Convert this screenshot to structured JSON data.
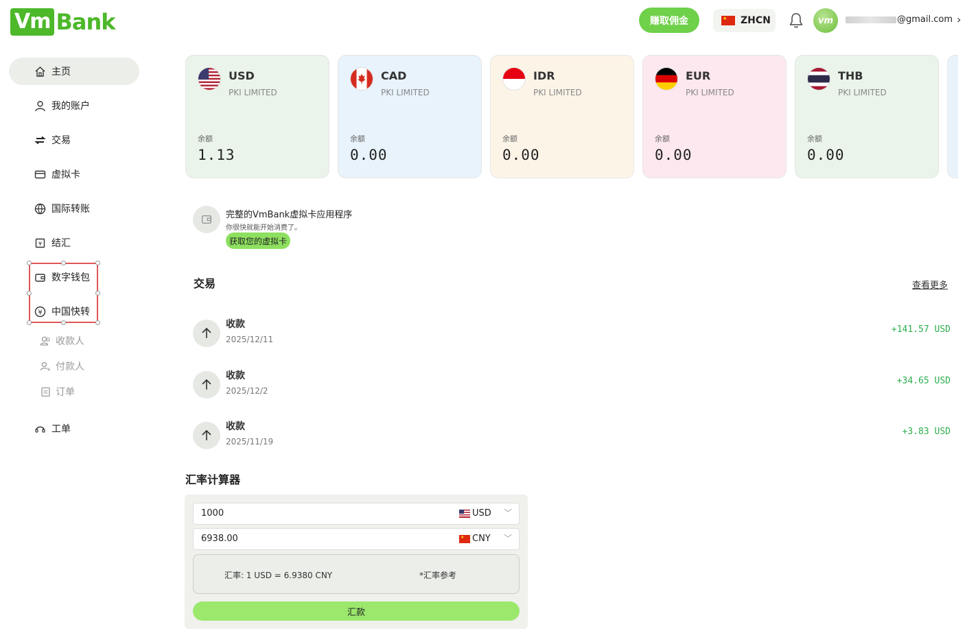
{
  "header": {
    "logo_box": "Vm",
    "logo_text": "Bank",
    "earn_button": "赚取佣金",
    "lang_label": "ZHCN",
    "avatar_text": "vm",
    "email_suffix": "@gmail.com"
  },
  "sidebar": {
    "items": [
      {
        "label": "主页",
        "icon": "home-icon"
      },
      {
        "label": "我的账户",
        "icon": "user-icon"
      },
      {
        "label": "交易",
        "icon": "transfer-icon"
      },
      {
        "label": "虚拟卡",
        "icon": "card-icon"
      },
      {
        "label": "国际转账",
        "icon": "globe-icon"
      },
      {
        "label": "结汇",
        "icon": "exchange-icon"
      },
      {
        "label": "数字钱包",
        "icon": "wallet-icon"
      },
      {
        "label": "中国快转",
        "icon": "yuan-icon"
      }
    ],
    "sub_items": [
      {
        "label": "收款人",
        "icon": "payee-icon"
      },
      {
        "label": "付款人",
        "icon": "payer-icon"
      },
      {
        "label": "订单",
        "icon": "order-icon"
      }
    ],
    "ticket": {
      "label": "工单",
      "icon": "headset-icon"
    }
  },
  "cards": [
    {
      "code": "USD",
      "holder": "PKI LIMITED",
      "balance_label": "余额",
      "balance": "1.13",
      "bg": "#eaf4ea"
    },
    {
      "code": "CAD",
      "holder": "PKI LIMITED",
      "balance_label": "余额",
      "balance": "0.00",
      "bg": "#e8f3fb"
    },
    {
      "code": "IDR",
      "holder": "PKI LIMITED",
      "balance_label": "余额",
      "balance": "0.00",
      "bg": "#fdf4e8"
    },
    {
      "code": "EUR",
      "holder": "PKI LIMITED",
      "balance_label": "余额",
      "balance": "0.00",
      "bg": "#fce8ee"
    },
    {
      "code": "THB",
      "holder": "PKI LIMITED",
      "balance_label": "余额",
      "balance": "0.00",
      "bg": "#eaf4ea"
    }
  ],
  "promo": {
    "title": "完整的VmBank虚拟卡应用程序",
    "subtitle": "你很快就能开始消费了。",
    "button": "获取您的虚拟卡"
  },
  "transactions": {
    "title": "交易",
    "view_more": "查看更多",
    "items": [
      {
        "title": "收款",
        "date": "2025/12/11",
        "amount": "+141.57 USD"
      },
      {
        "title": "收款",
        "date": "2025/12/2",
        "amount": "+34.65 USD"
      },
      {
        "title": "收款",
        "date": "2025/11/19",
        "amount": "+3.83 USD"
      }
    ]
  },
  "calculator": {
    "title": "汇率计算器",
    "from_value": "1000",
    "from_currency": "USD",
    "to_value": "6938.00",
    "to_currency": "CNY",
    "rate_text": "汇率:  1 USD = 6.9380 CNY",
    "rate_note": "*汇率参考",
    "button": "汇款"
  },
  "colors": {
    "brand": "#4cb82a",
    "positive": "#2eae4e",
    "selection": "#e05555"
  }
}
